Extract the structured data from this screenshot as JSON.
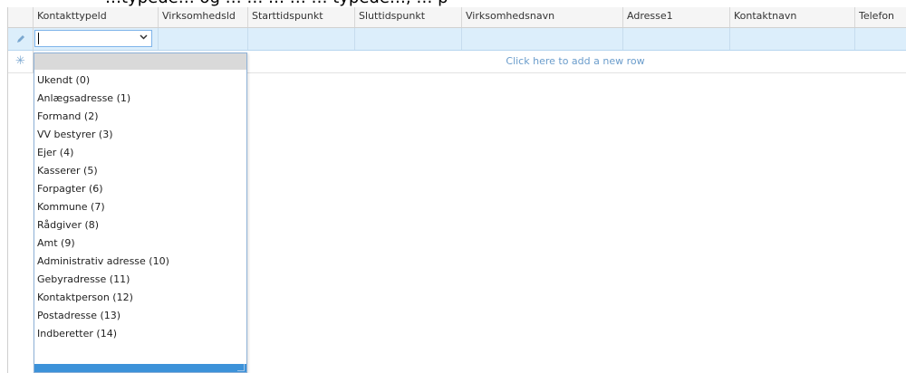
{
  "top_strip_text": "…typede… og … … … … … typede…, … p",
  "columns": [
    {
      "label": "Kontakttypeld"
    },
    {
      "label": "Virksomhedsld"
    },
    {
      "label": "Starttidspunkt"
    },
    {
      "label": "Sluttidspunkt"
    },
    {
      "label": "Virksomhedsnavn"
    },
    {
      "label": "Adresse1"
    },
    {
      "label": "Kontaktnavn"
    },
    {
      "label": "Telefon"
    }
  ],
  "edit_row": {
    "indicator_icon": "pencil-icon",
    "combo_value": "",
    "combo_arrow_icon": "chevron-down-icon"
  },
  "new_row": {
    "indicator_icon": "asterisk-icon",
    "prompt": "Click here to add a new row"
  },
  "dropdown": {
    "options": [
      "Ukendt  (0)",
      "Anlægsadresse  (1)",
      "Formand  (2)",
      "VV bestyrer  (3)",
      "Ejer  (4)",
      "Kasserer  (5)",
      "Forpagter  (6)",
      "Kommune  (7)",
      "Rådgiver  (8)",
      "Amt  (9)",
      "Administrativ adresse  (10)",
      "Gebyradresse  (11)",
      "Kontaktperson  (12)",
      "Postadresse  (13)",
      "Indberetter  (14)"
    ]
  },
  "colors": {
    "edit_row_bg": "#dceefb",
    "accent": "#3c92d9",
    "new_row_text": "#6a9ccb"
  }
}
